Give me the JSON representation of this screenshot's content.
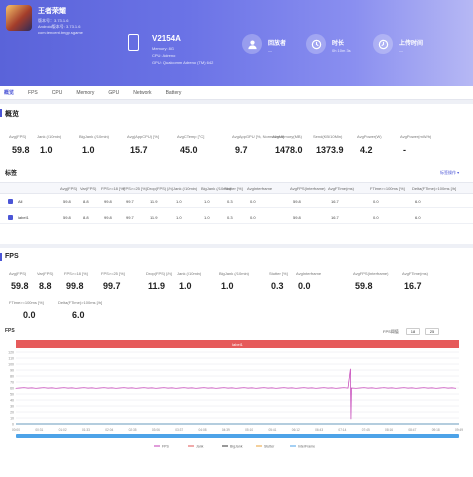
{
  "header": {
    "game_name": "王者荣耀",
    "game_lines": [
      "版本号：3.73.1.6",
      "Android版本号: 3.73.1.6",
      "com.tencent.tmgp.sgame"
    ],
    "device_name": "V2154A",
    "device_lines": [
      "Memory: 8G",
      "CPU: Adreno",
      "GPU: Qualcomm Adreno (TM) 642"
    ],
    "stats": [
      {
        "label": "回放者",
        "value": "—",
        "icon": "user-icon"
      },
      {
        "label": "时长",
        "value": "0h 10m 3s",
        "icon": "clock-icon"
      },
      {
        "label": "上传时间",
        "value": "—",
        "icon": "upload-time-icon"
      }
    ]
  },
  "tabs": [
    "概览",
    "FPS",
    "CPU",
    "Memory",
    "GPU",
    "Network",
    "Battery"
  ],
  "overview": {
    "title": "概览",
    "metrics": [
      {
        "label": "Avg(FPS)",
        "value": "59.8"
      },
      {
        "label": "Jank (/10min)",
        "value": "1.0"
      },
      {
        "label": "BigJank (/10min)",
        "value": "1.0"
      },
      {
        "label": "Avg(AppCPU) [%]",
        "value": "15.7"
      },
      {
        "label": "AvgCTemp [°C]",
        "value": "45.0"
      },
      {
        "label": "AvgAppGPU [%, Normalized]",
        "value": "9.7"
      },
      {
        "label": "AvgMemory(MB)",
        "value": "1478.0"
      },
      {
        "label": "Send(KB/10Min)",
        "value": "1373.9"
      },
      {
        "label": "AvgPower(W)",
        "value": "4.2"
      },
      {
        "label": "AvgPower(mW/h)",
        "value": "-"
      }
    ]
  },
  "labels": {
    "title": "标签",
    "action": "标签操作 ▾",
    "columns": [
      "Avg(FPS)",
      "Var(FPS)",
      "FPS>=18 [%]",
      "FPS>=25 [%]",
      "Drop(FPS) [/h]",
      "Jank (/10min)",
      "BigJank (/10min)",
      "Stutter [%]",
      "AvgInterframe",
      "AvgFPS(Interframe)",
      "AvgFTime(ms)",
      "FTime>=100ms [%]",
      "Delta(FTime)>100ms [/h]"
    ],
    "rows": [
      {
        "name": "All",
        "cells": [
          "59.8",
          "8.8",
          "99.8",
          "99.7",
          "11.9",
          "1.0",
          "1.0",
          "0.3",
          "0.0",
          "59.8",
          "16.7",
          "0.0",
          "6.0"
        ]
      },
      {
        "name": "label1",
        "cells": [
          "59.8",
          "8.8",
          "99.8",
          "99.7",
          "11.9",
          "1.0",
          "1.0",
          "0.3",
          "0.0",
          "59.8",
          "16.7",
          "0.0",
          "6.0"
        ]
      }
    ]
  },
  "fps_section": {
    "title": "FPS",
    "metrics_row1": [
      {
        "label": "Avg(FPS)",
        "value": "59.8"
      },
      {
        "label": "Var(FPS)",
        "value": "8.8"
      },
      {
        "label": "FPS>=18 [%]",
        "value": "99.8"
      },
      {
        "label": "FPS>=25 [%]",
        "value": "99.7"
      },
      {
        "label": "Drop(FPS) [/h]",
        "value": "11.9"
      },
      {
        "label": "Jank (/10min)",
        "value": "1.0"
      },
      {
        "label": "BigJank (/10min)",
        "value": "1.0"
      },
      {
        "label": "Stutter [%]",
        "value": "0.3"
      },
      {
        "label": "AvgInterframe",
        "value": "0.0"
      },
      {
        "label": "AvgFPS(Interframe)",
        "value": "59.8"
      },
      {
        "label": "AvgFTime(ms)",
        "value": "16.7"
      }
    ],
    "metrics_row2": [
      {
        "label": "FTime>=100ms [%]",
        "value": "0.0"
      },
      {
        "label": "Delta(FTime)>100ms [/h]",
        "value": "6.0"
      }
    ],
    "chart_label": "FPS",
    "threshold_label": "FPS阈值",
    "threshold_a": "18",
    "threshold_b": "25"
  },
  "chart_data": {
    "type": "line",
    "title": "label1",
    "ylim": [
      0,
      120
    ],
    "y_ticks": [
      "120",
      "110",
      "100",
      "90",
      "80",
      "70",
      "60",
      "50",
      "40",
      "30",
      "20",
      "10",
      "0"
    ],
    "x_ticks": [
      "00:00",
      "00:31",
      "01:02",
      "01:33",
      "02:04",
      "02:35",
      "03:06",
      "03:37",
      "04:08",
      "04:39",
      "05:10",
      "05:41",
      "06:12",
      "06:43",
      "07:14",
      "07:45",
      "08:16",
      "08:47",
      "09:18",
      "09:49"
    ],
    "series": [
      {
        "name": "FPS",
        "color": "#c23bb5",
        "baseline": 60,
        "spike_index": 14,
        "spike_value": 92,
        "dip_value": 8
      },
      {
        "name": "Jank",
        "color": "#e05555",
        "baseline": 0
      },
      {
        "name": "BigJank",
        "color": "#333333",
        "baseline": 0
      },
      {
        "name": "Stutter",
        "color": "#e8a23a",
        "baseline": 0
      },
      {
        "name": "InterFrame",
        "color": "#48a0e8",
        "baseline": 0
      }
    ]
  }
}
